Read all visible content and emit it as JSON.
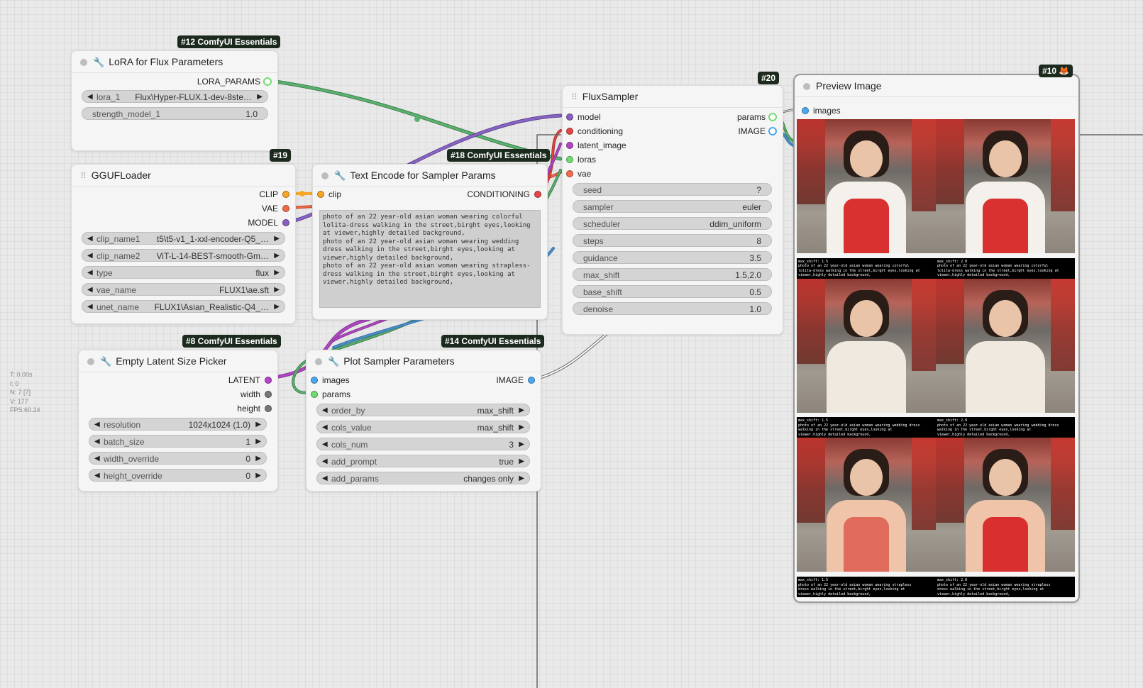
{
  "stats": [
    "T: 0.00s",
    "I: 0",
    "N: 7 [7]",
    "V: 177",
    "FPS:60.24"
  ],
  "colors": {
    "model": "#8a5fc1",
    "clip": "#f7a525",
    "vae": "#f26a4a",
    "conditioning": "#e64545",
    "latent": "#b445c7",
    "loras": "#6fdc6f",
    "image": "#4aa8f0",
    "params": "#6fdc6f",
    "int": "#777777",
    "link_green": "#4f9a5e",
    "link_purple": "#7a5aa8",
    "link_blue": "#4a8fc8"
  },
  "nodes": {
    "lora": {
      "badge": "#12 ComfyUI Essentials",
      "title": "LoRA for Flux Parameters",
      "outputs": [
        "LORA_PARAMS"
      ],
      "widgets": [
        {
          "label": "lora_1",
          "value": "Flux\\Hyper-FLUX.1-dev-8ste…"
        },
        {
          "label": "strength_model_1",
          "value": "1.0"
        }
      ]
    },
    "gguf": {
      "badge": "#19",
      "title": "GGUFLoader",
      "outputs": [
        "CLIP",
        "VAE",
        "MODEL"
      ],
      "widgets": [
        {
          "label": "clip_name1",
          "value": "t5\\t5-v1_1-xxl-encoder-Q5_…"
        },
        {
          "label": "clip_name2",
          "value": "ViT-L-14-BEST-smooth-Gm…"
        },
        {
          "label": "type",
          "value": "flux"
        },
        {
          "label": "vae_name",
          "value": "FLUX1\\ae.sft"
        },
        {
          "label": "unet_name",
          "value": "FLUX1\\Asian_Realistic-Q4_…"
        }
      ]
    },
    "text_encode": {
      "badge": "#18 ComfyUI Essentials",
      "title": "Text Encode for Sampler Params",
      "inputs": [
        "clip"
      ],
      "outputs": [
        "CONDITIONING"
      ],
      "prompt": "photo of an 22 year-old asian woman wearing colorful lolita-dress walking in the street,birght eyes,looking at viewer,highly detailed background,\nphoto of an 22 year-old asian woman wearing wedding dress walking in the street,birght eyes,looking at viewer,highly detailed background,\nphoto of an 22 year-old asian woman wearing strapless-dress walking in the street,birght eyes,looking at viewer,highly detailed background,"
    },
    "empty_latent": {
      "badge": "#8 ComfyUI Essentials",
      "title": "Empty Latent Size Picker",
      "outputs": [
        "LATENT",
        "width",
        "height"
      ],
      "widgets": [
        {
          "label": "resolution",
          "value": "1024x1024 (1.0)"
        },
        {
          "label": "batch_size",
          "value": "1"
        },
        {
          "label": "width_override",
          "value": "0"
        },
        {
          "label": "height_override",
          "value": "0"
        }
      ]
    },
    "plot": {
      "badge": "#14 ComfyUI Essentials",
      "title": "Plot Sampler Parameters",
      "inputs": [
        "images",
        "params"
      ],
      "outputs": [
        "IMAGE"
      ],
      "widgets": [
        {
          "label": "order_by",
          "value": "max_shift"
        },
        {
          "label": "cols_value",
          "value": "max_shift"
        },
        {
          "label": "cols_num",
          "value": "3"
        },
        {
          "label": "add_prompt",
          "value": "true"
        },
        {
          "label": "add_params",
          "value": "changes only"
        }
      ]
    },
    "flux_sampler": {
      "badge": "#20",
      "title": "FluxSampler",
      "inputs": [
        "model",
        "conditioning",
        "latent_image",
        "loras",
        "vae"
      ],
      "outputs": [
        "params",
        "IMAGE"
      ],
      "widgets": [
        {
          "label": "seed",
          "value": "?"
        },
        {
          "label": "sampler",
          "value": "euler"
        },
        {
          "label": "scheduler",
          "value": "ddim_uniform"
        },
        {
          "label": "steps",
          "value": "8"
        },
        {
          "label": "guidance",
          "value": "3.5"
        },
        {
          "label": "max_shift",
          "value": "1.5,2.0"
        },
        {
          "label": "base_shift",
          "value": "0.5"
        },
        {
          "label": "denoise",
          "value": "1.0"
        }
      ]
    },
    "preview": {
      "badge": "#10",
      "badge_icon": "fox-icon",
      "title": "Preview Image",
      "inputs": [
        "images"
      ],
      "cells": [
        {
          "caption": [
            "max_shift: 1.5",
            "photo of an 22 year-old asian woman wearing colorful",
            "lolita-dress walking in the street,birght eyes,looking at",
            "viewer,highly detailed background,"
          ],
          "dress": "#d8312f",
          "sleeve": "#f4f1ec"
        },
        {
          "caption": [
            "max_shift: 2.0",
            "photo of an 22 year-old asian woman wearing colorful",
            "lolita-dress walking in the street,birght eyes,looking at",
            "viewer,highly detailed background,"
          ],
          "dress": "#d8312f",
          "sleeve": "#f4f1ec"
        },
        {
          "caption": [
            "max_shift: 1.5",
            "photo of an 22 year-old asian woman wearing wedding dress",
            "walking in the street,birght eyes,looking at",
            "viewer,highly detailed background,"
          ],
          "dress": "#efe9df",
          "sleeve": "#efe9df"
        },
        {
          "caption": [
            "max_shift: 2.0",
            "photo of an 22 year-old asian woman wearing wedding dress",
            "walking in the street,birght eyes,looking at",
            "viewer,highly detailed background,"
          ],
          "dress": "#efe9df",
          "sleeve": "#efe9df"
        },
        {
          "caption": [
            "max_shift: 1.5",
            "photo of an 22 year-old asian woman wearing strapless",
            "dress walking in the street,birght eyes,looking at",
            "viewer,highly detailed background,"
          ],
          "dress": "#e06a5c",
          "sleeve": "#efc4a8"
        },
        {
          "caption": [
            "max_shift: 2.0",
            "photo of an 22 year-old asian woman wearing strapless",
            "dress walking in the street,birght eyes,looking at",
            "viewer,highly detailed background,"
          ],
          "dress": "#d9302f",
          "sleeve": "#efc4a8"
        }
      ]
    }
  }
}
